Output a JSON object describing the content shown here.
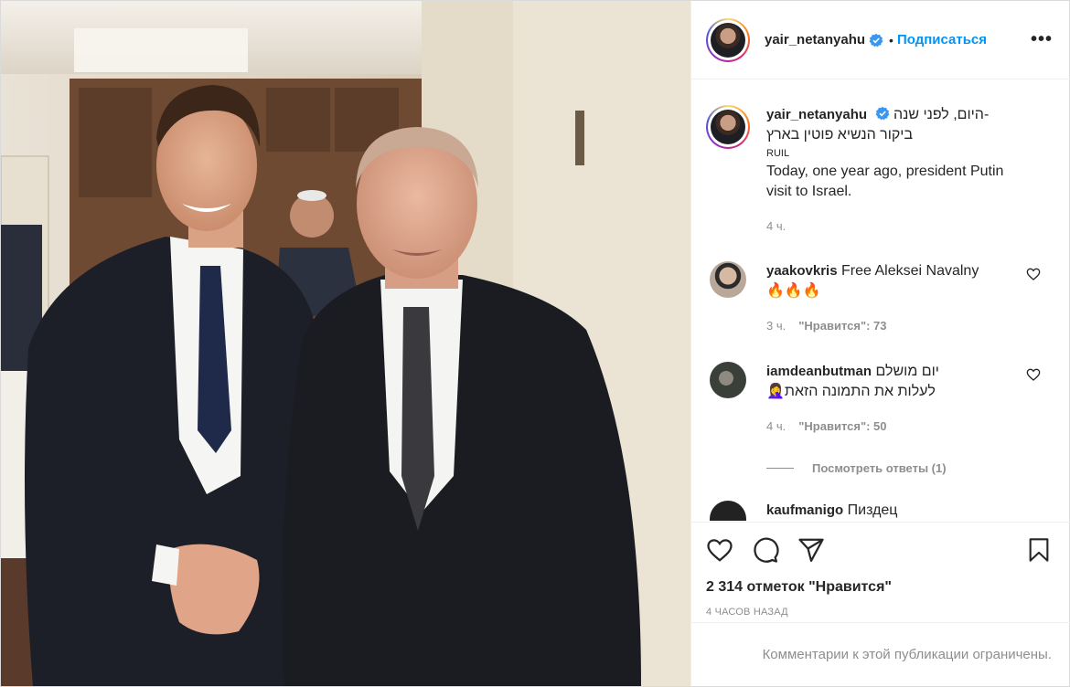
{
  "post": {
    "username": "yair_netanyahu",
    "follow_label": "Подписаться",
    "more_label": "•••"
  },
  "caption": {
    "username": "yair_netanyahu",
    "hebrew_line1": "היום, לפני שנה-",
    "hebrew_line2": "ביקור הנשיא פוטין בארץ",
    "tag": "RUIL",
    "english": "Today, one year ago, president Putin visit to Israel.",
    "time": "4 ч."
  },
  "comments": [
    {
      "username": "yaakovkris",
      "text": "Free Aleksei Navalny",
      "emoji": "🔥🔥🔥",
      "time": "3 ч.",
      "likes": "\"Нравится\": 73",
      "avatar_color": "#b9a89a"
    },
    {
      "username": "iamdeanbutman",
      "text": "יום מושלם",
      "text2": "לעלות את התמונה הזאת🤦‍♀️",
      "time": "4 ч.",
      "likes": "\"Нравится\": 50",
      "avatar_color": "#4a4f48",
      "replies_label": "Посмотреть ответы (1)"
    },
    {
      "username": "kaufmanigo",
      "text": "Пиздец",
      "avatar_color": "#222"
    }
  ],
  "stats": {
    "likes_label": "2 314 отметок \"Нравится\"",
    "posted": "4 ЧАСОВ НАЗАД"
  },
  "footer": {
    "restricted": "Комментарии к этой публикации ограничены."
  },
  "colors": {
    "accent": "#0095f6",
    "muted": "#8e8e8e",
    "text": "#262626"
  }
}
